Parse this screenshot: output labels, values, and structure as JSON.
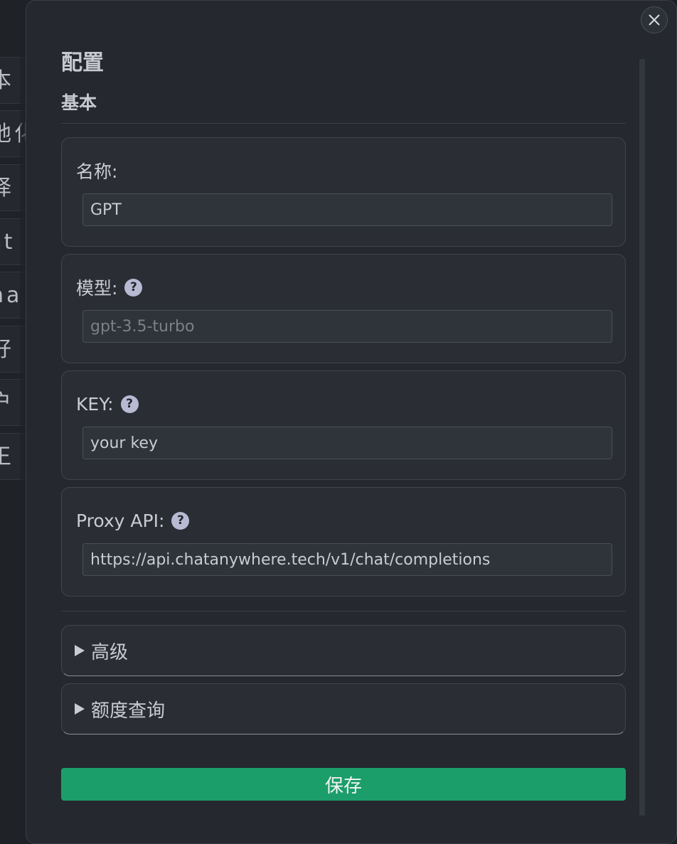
{
  "background_sidebar": {
    "items": [
      "本",
      "地化",
      "择",
      "st",
      "na",
      "好",
      "户",
      "王"
    ]
  },
  "modal": {
    "close_icon": "close-icon",
    "title": "配置",
    "section_basic": "基本",
    "fields": {
      "name": {
        "label": "名称:",
        "value": "GPT",
        "placeholder": ""
      },
      "model": {
        "label": "模型:",
        "value": "",
        "placeholder": "gpt-3.5-turbo",
        "help": "?"
      },
      "key": {
        "label": "KEY:",
        "value": "your key",
        "placeholder": "",
        "help": "?"
      },
      "proxy": {
        "label": "Proxy API:",
        "value": "https://api.chatanywhere.tech/v1/chat/completions",
        "placeholder": "",
        "help": "?"
      }
    },
    "sections": {
      "advanced": "高级",
      "quota": "额度查询"
    },
    "save_label": "保存"
  },
  "colors": {
    "accent": "#1c9e6a",
    "panel_bg": "#25282e",
    "card_bg": "#2a2e34",
    "help_icon": "#b7bad2"
  }
}
